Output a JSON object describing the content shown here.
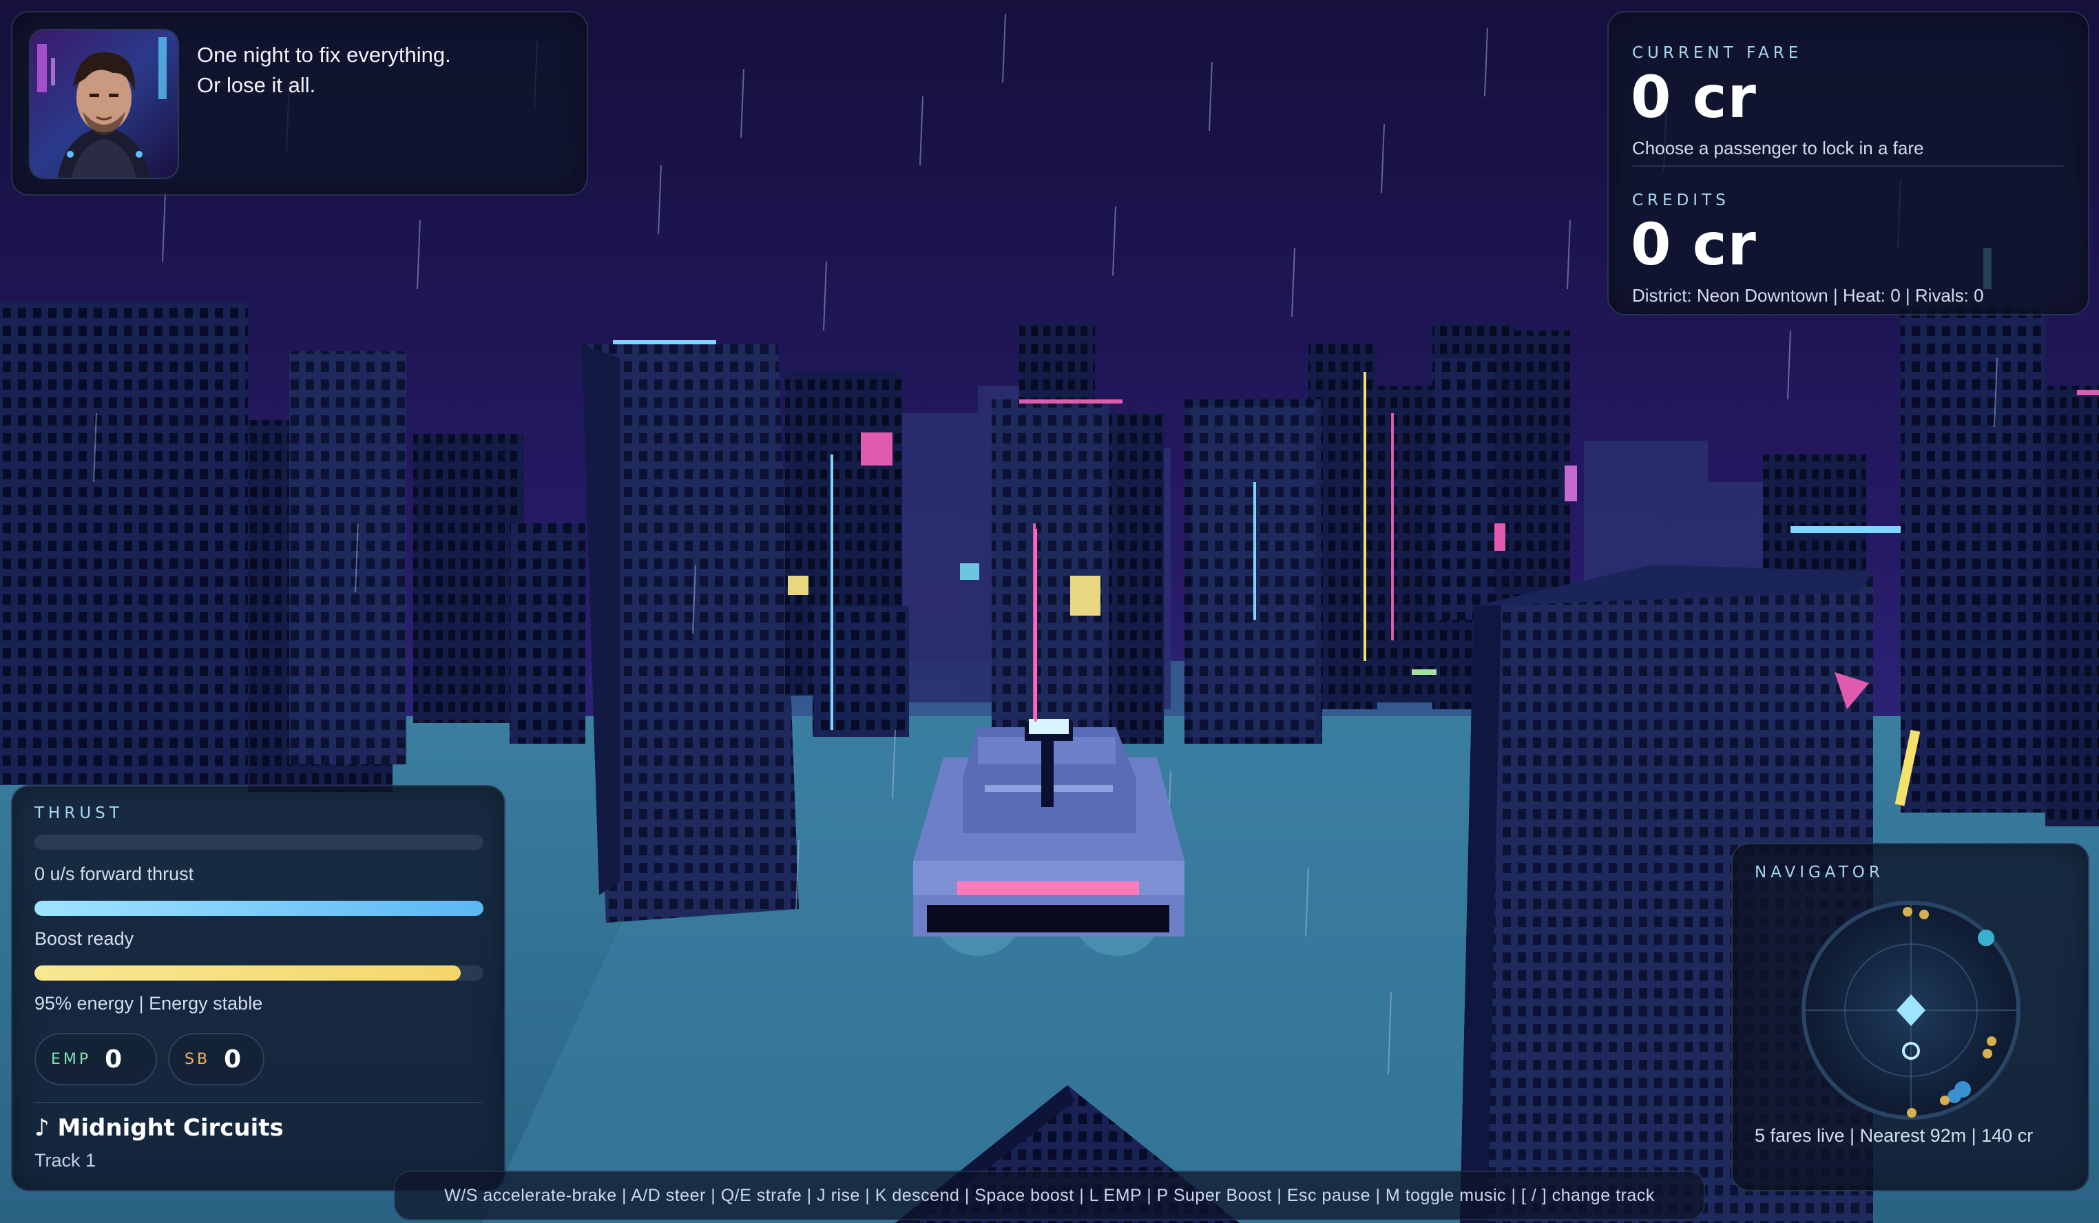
{
  "story": {
    "line1": "One night to fix everything.",
    "line2": "Or lose it all."
  },
  "fare": {
    "current_label": "CURRENT FARE",
    "current_value": "0 cr",
    "current_hint": "Choose a passenger to lock in a fare",
    "credits_label": "CREDITS",
    "credits_value": "0 cr",
    "status_line": "District: Neon Downtown | Heat: 0 | Rivals: 0"
  },
  "thrust": {
    "label": "THRUST",
    "forward_fraction": 0,
    "forward_text": "0 u/s forward thrust",
    "boost_fraction": 1.0,
    "boost_text": "Boost ready",
    "energy_fraction": 0.95,
    "energy_text": "95% energy | Energy stable",
    "emp_label": "EMP",
    "emp_count": "0",
    "sb_label": "SB",
    "sb_count": "0"
  },
  "music": {
    "note_icon": "music-note-icon",
    "title": "Midnight Circuits",
    "track": "Track 1"
  },
  "navigator": {
    "label": "NAVIGATOR",
    "summary": "5 fares live | Nearest 92m | 140 cr"
  },
  "controls": {
    "text": "W/S accelerate-brake | A/D steer | Q/E strafe | J rise | K descend | Space boost | L EMP | P Super Boost | Esc pause | M toggle music | [ / ] change track"
  },
  "colors": {
    "accent_cyan": "#7fd6ff",
    "boost_blue": "#5ab8f5",
    "energy_yellow": "#f5d66a",
    "emp_green": "#7fe3b0",
    "sb_orange": "#f5b36a",
    "neon_pink": "#e05aae",
    "sky": "#1b1650"
  }
}
